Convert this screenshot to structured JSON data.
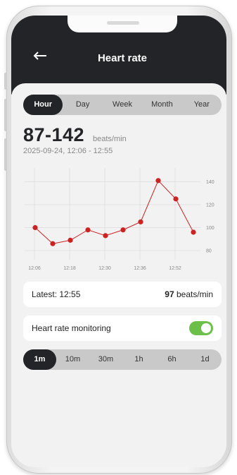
{
  "header": {
    "title": "Heart rate",
    "back_icon": "arrow-left-icon"
  },
  "period_tabs": [
    {
      "label": "Hour",
      "active": true
    },
    {
      "label": "Day",
      "active": false
    },
    {
      "label": "Week",
      "active": false
    },
    {
      "label": "Month",
      "active": false
    },
    {
      "label": "Year",
      "active": false
    }
  ],
  "summary": {
    "range": "87-142",
    "unit": "beats/min",
    "time": "2025-09-24, 12:06 - 12:55"
  },
  "chart_data": {
    "type": "line",
    "x_tick_labels": [
      "12:06",
      "12:18",
      "12:30",
      "12:36",
      "12:52"
    ],
    "y_ticks": [
      80,
      100,
      120,
      140
    ],
    "ylim": [
      72,
      152
    ],
    "values": [
      100,
      86,
      89,
      98,
      93,
      98,
      105,
      141,
      125,
      96
    ],
    "line_color": "#cc2222",
    "point_color": "#cc2222",
    "grid": true,
    "y_axis_side": "right"
  },
  "latest": {
    "label": "Latest: 12:55",
    "value": "97",
    "unit": " beats/min"
  },
  "monitoring": {
    "label": "Heart rate monitoring",
    "enabled": true,
    "accent": "#6cc04a"
  },
  "interval_tabs": [
    {
      "label": "1m",
      "active": true
    },
    {
      "label": "10m",
      "active": false
    },
    {
      "label": "30m",
      "active": false
    },
    {
      "label": "1h",
      "active": false
    },
    {
      "label": "6h",
      "active": false
    },
    {
      "label": "1d",
      "active": false
    }
  ]
}
